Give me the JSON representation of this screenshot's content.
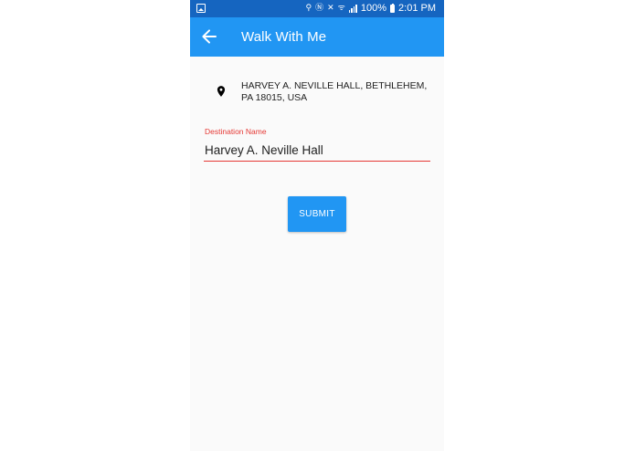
{
  "status_bar": {
    "battery_text": "100%",
    "time": "2:01 PM",
    "icons": [
      "image-icon",
      "location-icon",
      "nfc-icon",
      "mute-icon",
      "wifi-icon",
      "signal-icon",
      "battery-icon"
    ]
  },
  "app_bar": {
    "title": "Walk With Me",
    "back_icon": "arrow-left-icon",
    "color": "#2196f3",
    "status_color": "#1565c0"
  },
  "location": {
    "icon": "map-pin-icon",
    "address": "HARVEY A. NEVILLE HALL, BETHLEHEM, PA 18015, USA"
  },
  "form": {
    "field_label": "Destination Name",
    "field_value": "Harvey A. Neville Hall",
    "accent_color": "#e53935"
  },
  "actions": {
    "submit_label": "SUBMIT"
  }
}
